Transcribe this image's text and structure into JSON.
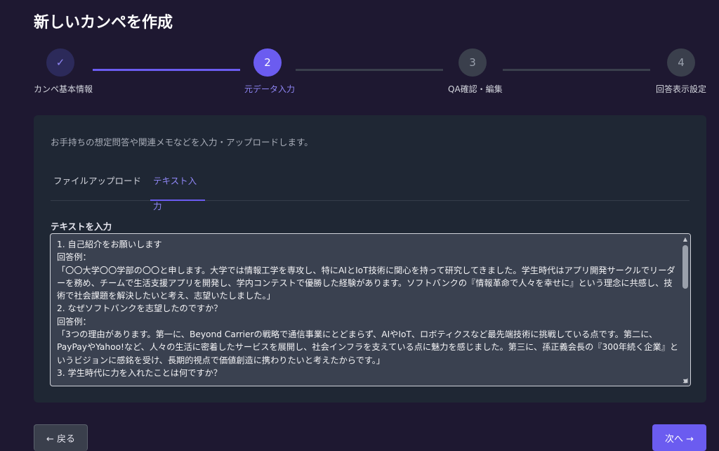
{
  "page": {
    "title": "新しいカンペを作成"
  },
  "stepper": {
    "steps": [
      {
        "number": "",
        "label": "カンペ基本情報",
        "state": "done"
      },
      {
        "number": "2",
        "label": "元データ入力",
        "state": "active"
      },
      {
        "number": "3",
        "label": "QA確認・編集",
        "state": "pending"
      },
      {
        "number": "4",
        "label": "回答表示設定",
        "state": "pending"
      }
    ],
    "check_glyph": "✓"
  },
  "panel": {
    "description": "お手持ちの想定問答や関連メモなどを入力・アップロードします。",
    "tabs": [
      {
        "label": "ファイルアップロード",
        "active": false
      },
      {
        "label": "テキスト入力",
        "active": true
      }
    ],
    "text_field": {
      "label": "テキストを入力",
      "value": "1. 自己紹介をお願いします\n回答例：\n「〇〇大学〇〇学部の〇〇と申します。大学では情報工学を専攻し、特にAIとIoT技術に関心を持って研究してきました。学生時代はアプリ開発サークルでリーダーを務め、チームで生活支援アプリを開発し、学内コンテストで優勝した経験があります。ソフトバンクの『情報革命で人々を幸せに』という理念に共感し、技術で社会課題を解決したいと考え、志望いたしました。」\n2. なぜソフトバンクを志望したのですか？\n回答例：\n「3つの理由があります。第一に、Beyond Carrierの戦略で通信事業にとどまらず、AIやIoT、ロボティクスなど最先端技術に挑戦している点です。第二に、PayPayやYahoo!など、人々の生活に密着したサービスを展開し、社会インフラを支えている点に魅力を感じました。第三に、孫正義会長の『300年続く企業』というビジョンに感銘を受け、長期的視点で価値創造に携わりたいと考えたからです。」\n3. 学生時代に力を入れたことは何ですか？"
    }
  },
  "footer": {
    "back_label": "← 戻る",
    "next_label": "次へ →"
  },
  "colors": {
    "background": "#1e1831",
    "accent": "#6b5cf0",
    "panel": "#1f2734"
  }
}
